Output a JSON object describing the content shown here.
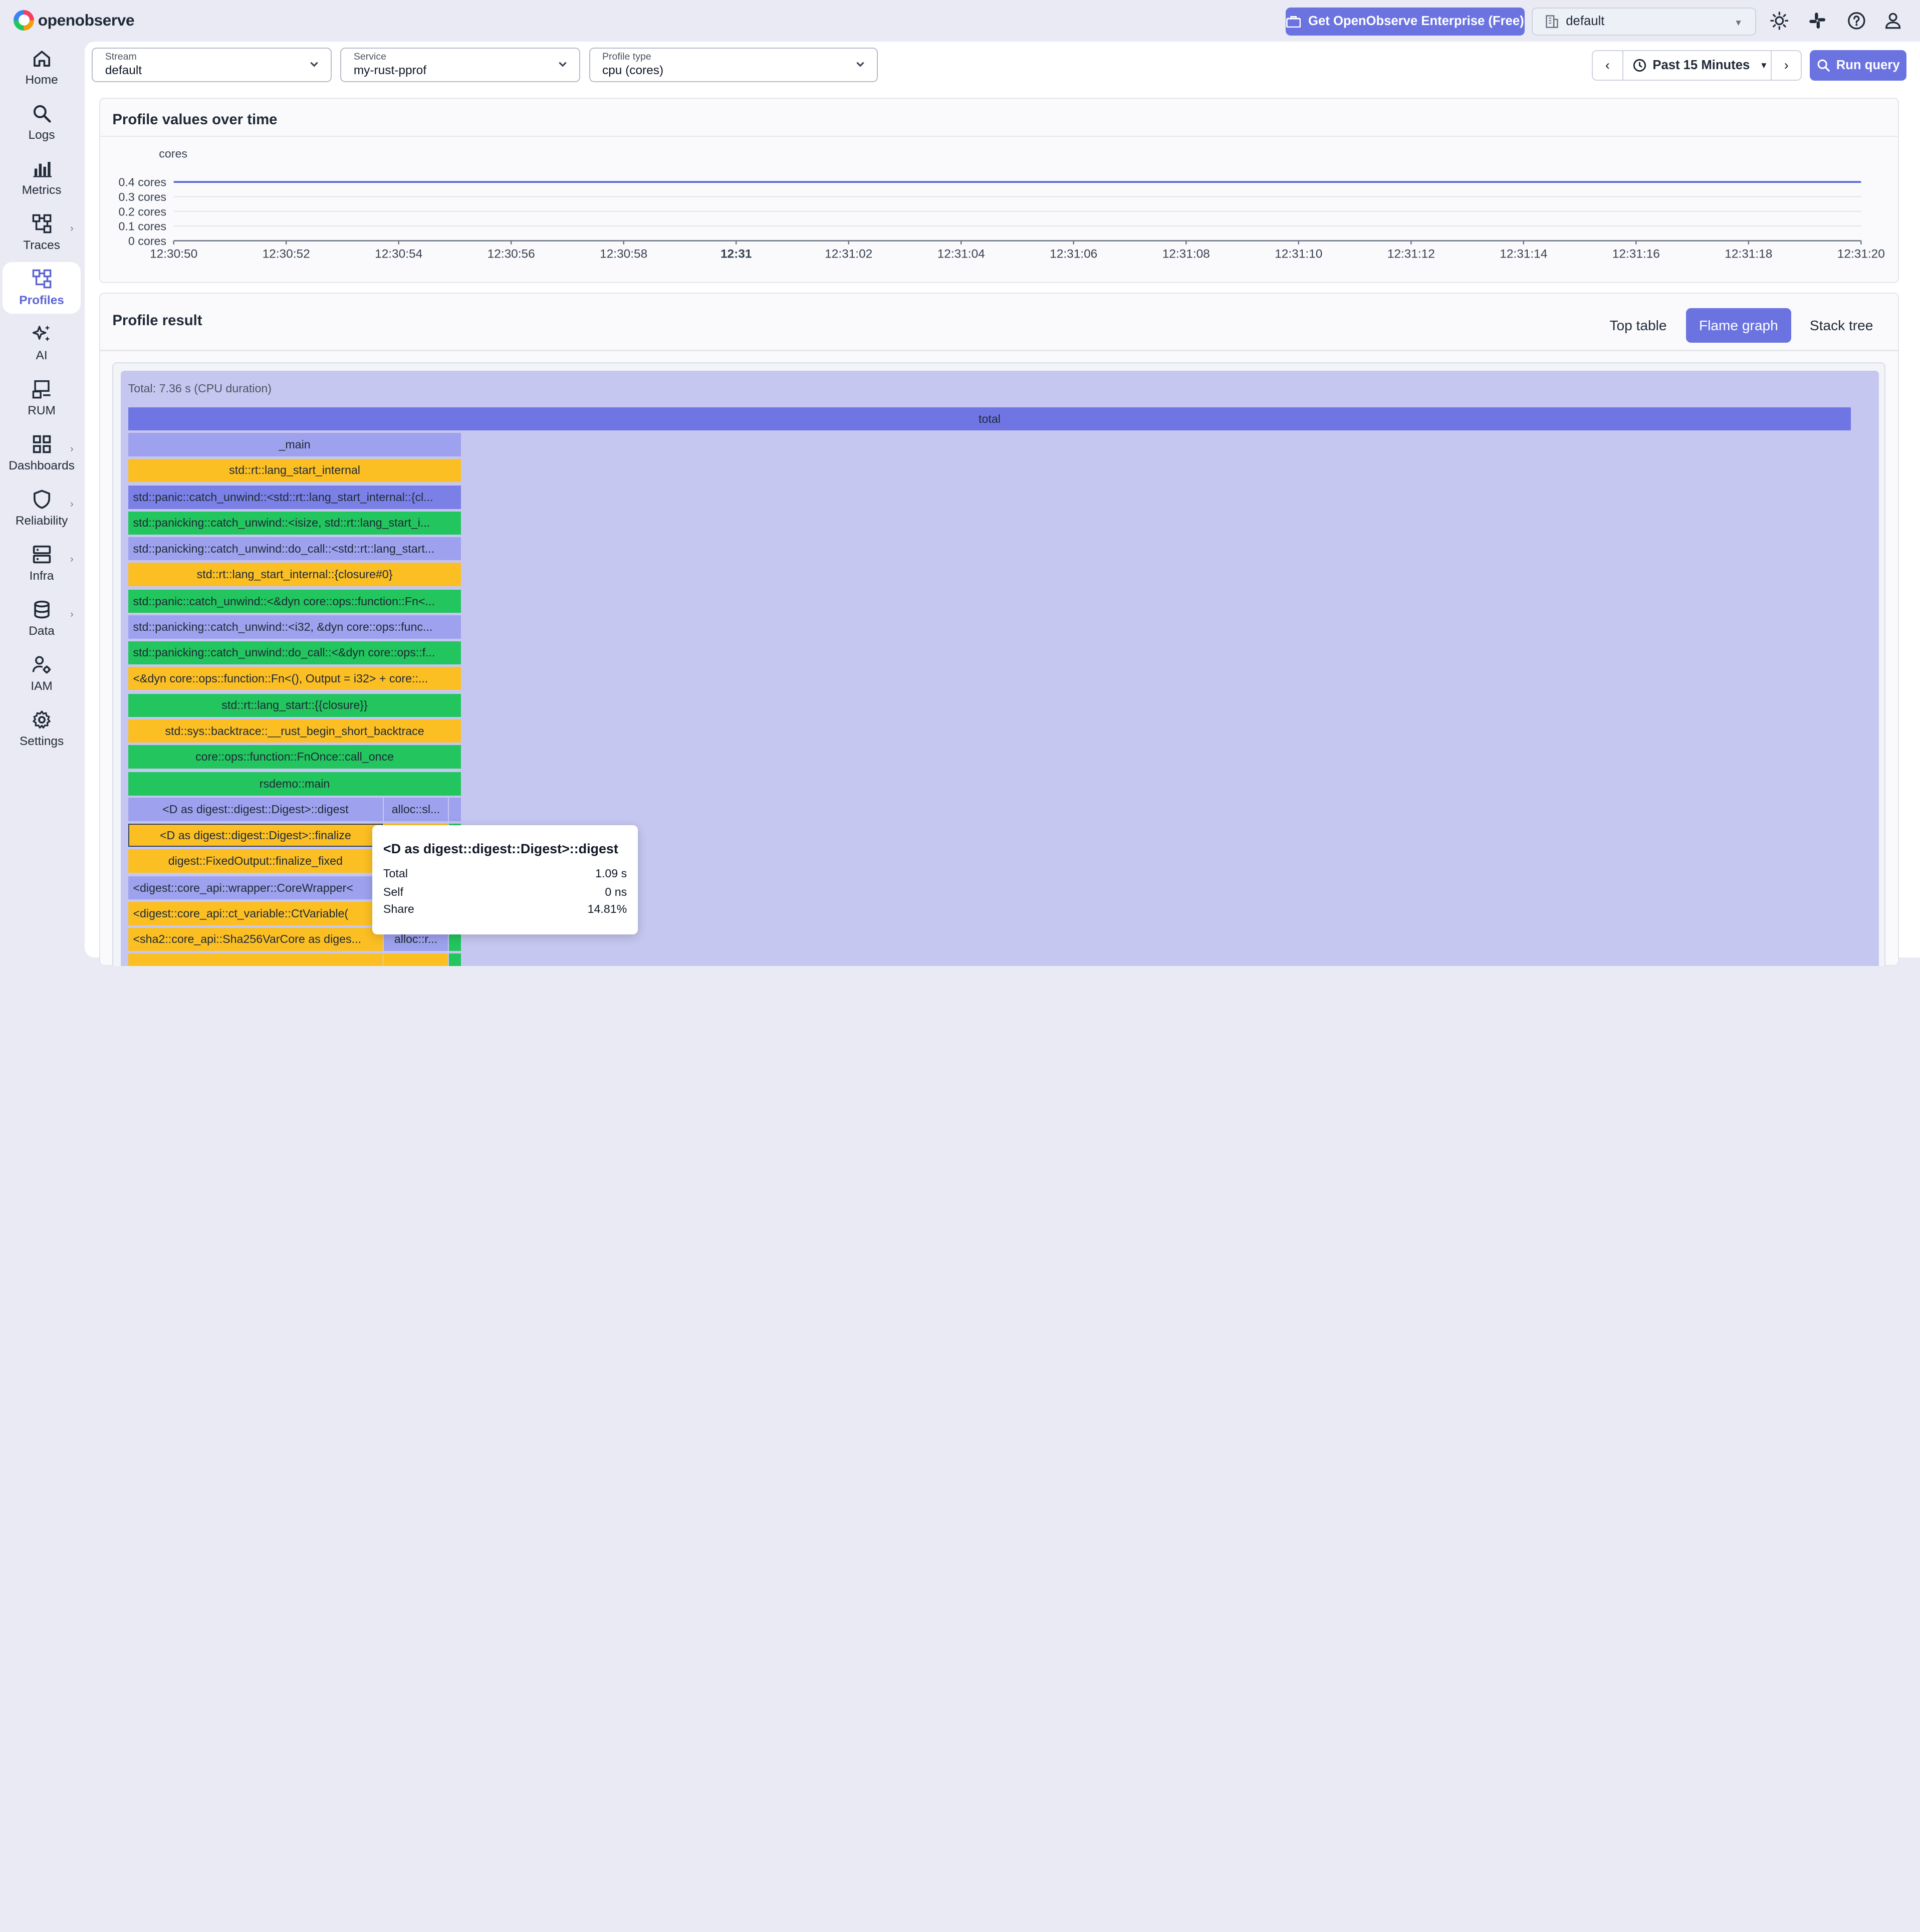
{
  "app": {
    "logo_text": "openobserve"
  },
  "topbar": {
    "enterprise_label": "Get OpenObserve Enterprise (Free)",
    "org_value": "default"
  },
  "sidebar": {
    "items": [
      {
        "label": "Home",
        "icon": "home-icon"
      },
      {
        "label": "Logs",
        "icon": "search-icon"
      },
      {
        "label": "Metrics",
        "icon": "bar-chart-icon"
      },
      {
        "label": "Traces",
        "icon": "traces-icon"
      },
      {
        "label": "Profiles",
        "icon": "profiles-icon"
      },
      {
        "label": "AI",
        "icon": "sparkle-icon"
      },
      {
        "label": "RUM",
        "icon": "devices-icon"
      },
      {
        "label": "Dashboards",
        "icon": "grid-icon"
      },
      {
        "label": "Reliability",
        "icon": "shield-icon"
      },
      {
        "label": "Infra",
        "icon": "server-icon"
      },
      {
        "label": "Data",
        "icon": "database-icon"
      },
      {
        "label": "IAM",
        "icon": "users-gear-icon"
      },
      {
        "label": "Settings",
        "icon": "gear-icon"
      }
    ],
    "active": "Profiles"
  },
  "filters": {
    "stream": {
      "label": "Stream",
      "value": "default"
    },
    "service": {
      "label": "Service",
      "value": "my-rust-pprof"
    },
    "profile_type": {
      "label": "Profile type",
      "value": "cpu (cores)"
    }
  },
  "time_range": {
    "label": "Past 15 Minutes"
  },
  "run_query_label": "Run query",
  "timeseries": {
    "title": "Profile values over time",
    "unit_label": "cores"
  },
  "chart_data": {
    "type": "line",
    "title": "Profile values over time",
    "ylabel": "cores",
    "ytick_labels": [
      "0.4 cores",
      "0.3 cores",
      "0.2 cores",
      "0.1 cores",
      "0 cores"
    ],
    "ylim": [
      0,
      0.4
    ],
    "x_labels": [
      "12:30:50",
      "12:30:52",
      "12:30:54",
      "12:30:56",
      "12:30:58",
      "12:31",
      "12:31:02",
      "12:31:04",
      "12:31:06",
      "12:31:08",
      "12:31:10",
      "12:31:12",
      "12:31:14",
      "12:31:16",
      "12:31:18",
      "12:31:20"
    ],
    "bold_x_label": "12:31",
    "series": [
      {
        "values": [
          0.4,
          0.4,
          0.4,
          0.4,
          0.4,
          0.4,
          0.4,
          0.4,
          0.4,
          0.4,
          0.4,
          0.4,
          0.4,
          0.4,
          0.4,
          0.4
        ]
      }
    ],
    "grid": true,
    "color": "#5b63d6"
  },
  "profile_result": {
    "title": "Profile result",
    "tabs": [
      "Top table",
      "Flame graph",
      "Stack tree"
    ],
    "active_tab": "Flame graph",
    "total_label": "Total: 7.36 s (CPU duration)",
    "frames": [
      {
        "text": "total"
      },
      {
        "text": "_main"
      },
      {
        "text": "std::rt::lang_start_internal"
      },
      {
        "text": "std::panic::catch_unwind::<std::rt::lang_start_internal::{cl..."
      },
      {
        "text": "std::panicking::catch_unwind::<isize, std::rt::lang_start_i..."
      },
      {
        "text": "std::panicking::catch_unwind::do_call::<std::rt::lang_start..."
      },
      {
        "text": "std::rt::lang_start_internal::{closure#0}"
      },
      {
        "text": "std::panic::catch_unwind::<&dyn core::ops::function::Fn<..."
      },
      {
        "text": "std::panicking::catch_unwind::<i32, &dyn core::ops::func..."
      },
      {
        "text": "std::panicking::catch_unwind::do_call::<&dyn core::ops::f..."
      },
      {
        "text": "<&dyn core::ops::function::Fn<(), Output = i32> + core::..."
      },
      {
        "text": "std::rt::lang_start::{{closure}}"
      },
      {
        "text": "std::sys::backtrace::__rust_begin_short_backtrace"
      },
      {
        "text": "core::ops::function::FnOnce::call_once"
      },
      {
        "text": "rsdemo::main"
      },
      {
        "text": "<D as digest::digest::Digest>::digest"
      },
      {
        "text": "alloc::sl..."
      },
      {
        "text": "<D as digest::digest::Digest>::finalize"
      },
      {
        "text": "digest::FixedOutput::finalize_fixed"
      },
      {
        "text": "<digest::core_api::wrapper::CoreWrapper<"
      },
      {
        "text": "<digest::core_api::ct_variable::CtVariable("
      },
      {
        "text": "<sha2::core_api::Sha256VarCore as diges..."
      },
      {
        "text": "alloc::r..."
      }
    ]
  },
  "tooltip": {
    "title": "<D as digest::digest::Digest>::digest",
    "rows": [
      {
        "label": "Total",
        "value": "1.09 s"
      },
      {
        "label": "Self",
        "value": "0 ns"
      },
      {
        "label": "Share",
        "value": "14.81%"
      }
    ]
  }
}
